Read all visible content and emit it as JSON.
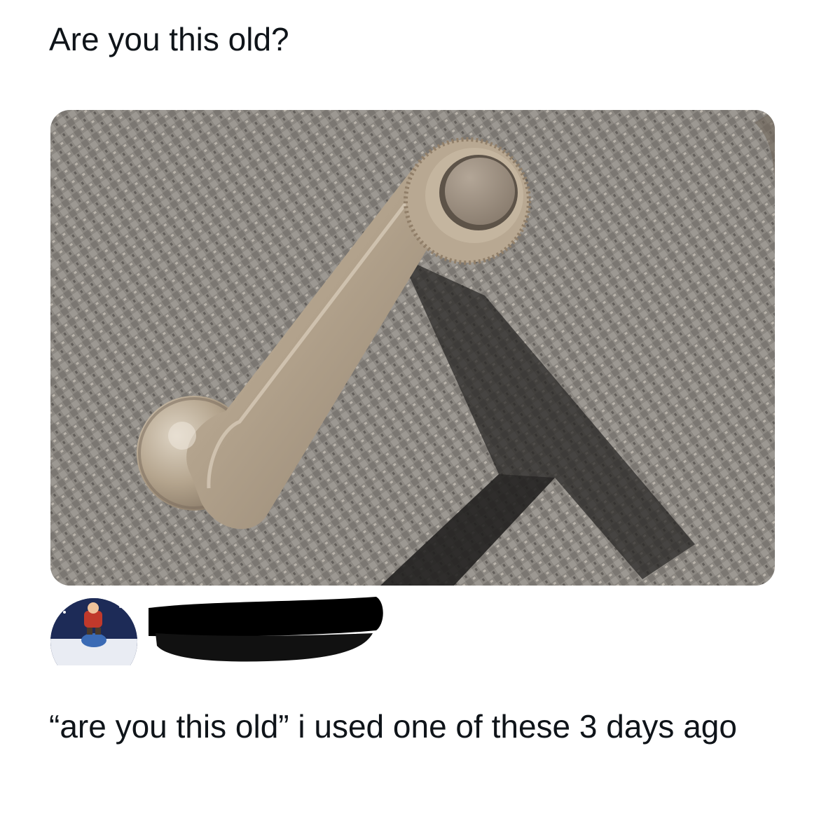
{
  "quoted_tweet": {
    "text": "Are you this old?"
  },
  "media": {
    "icon": "car-window-crank-photo",
    "colors": {
      "fabric": "#8d8a86",
      "handle": "#b3a48f",
      "shadow": "#2f2d2c"
    }
  },
  "author": {
    "avatar_icon": "cartoon-character-avatar",
    "name_redacted": true,
    "redaction_color": "#000000"
  },
  "reply": {
    "text": "“are you this old” i used one of these 3 days ago"
  }
}
